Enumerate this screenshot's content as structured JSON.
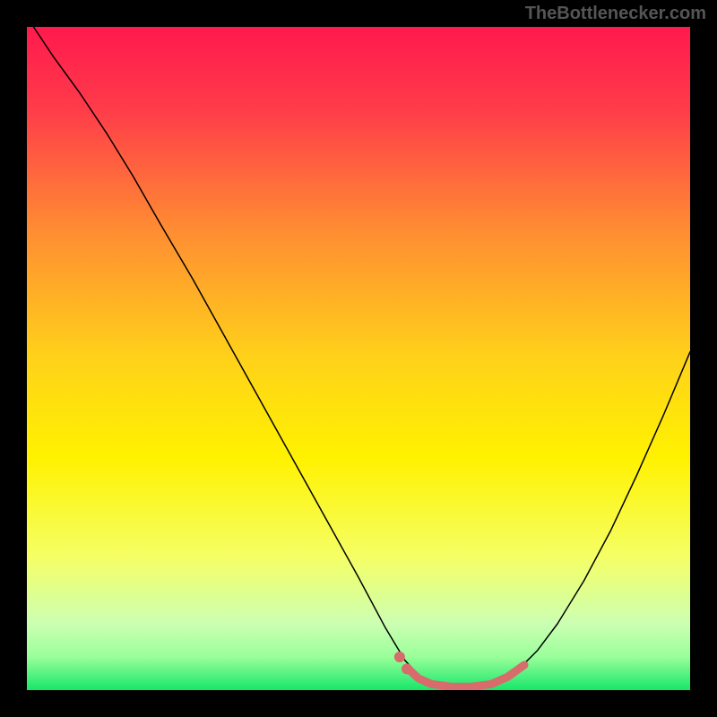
{
  "watermark": "TheBottlenecker.com",
  "chart_data": {
    "type": "line",
    "title": "",
    "xlabel": "",
    "ylabel": "",
    "xlim": [
      0,
      100
    ],
    "ylim": [
      0,
      100
    ],
    "background_gradient_stops": [
      {
        "pct": 0,
        "color": "#ff1a4d"
      },
      {
        "pct": 12,
        "color": "#ff3a4a"
      },
      {
        "pct": 30,
        "color": "#ff8a33"
      },
      {
        "pct": 50,
        "color": "#ffd21a"
      },
      {
        "pct": 65,
        "color": "#fff200"
      },
      {
        "pct": 80,
        "color": "#f5ff66"
      },
      {
        "pct": 90,
        "color": "#ccffb3"
      },
      {
        "pct": 95,
        "color": "#99ff99"
      },
      {
        "pct": 100,
        "color": "#17e66b"
      }
    ],
    "series": [
      {
        "name": "bottleneck-curve",
        "color": "#000000",
        "width": 1.5,
        "points": [
          {
            "x": 1.0,
            "y": 100.0
          },
          {
            "x": 4.0,
            "y": 95.5
          },
          {
            "x": 8.0,
            "y": 90.0
          },
          {
            "x": 12.0,
            "y": 84.0
          },
          {
            "x": 16.0,
            "y": 77.5
          },
          {
            "x": 20.0,
            "y": 70.5
          },
          {
            "x": 25.0,
            "y": 62.0
          },
          {
            "x": 30.0,
            "y": 53.0
          },
          {
            "x": 35.0,
            "y": 44.0
          },
          {
            "x": 40.0,
            "y": 35.0
          },
          {
            "x": 45.0,
            "y": 26.0
          },
          {
            "x": 50.0,
            "y": 17.0
          },
          {
            "x": 54.0,
            "y": 9.5
          },
          {
            "x": 57.0,
            "y": 4.5
          },
          {
            "x": 59.5,
            "y": 1.8
          },
          {
            "x": 62.0,
            "y": 0.6
          },
          {
            "x": 65.0,
            "y": 0.3
          },
          {
            "x": 68.0,
            "y": 0.5
          },
          {
            "x": 71.0,
            "y": 1.2
          },
          {
            "x": 74.0,
            "y": 3.0
          },
          {
            "x": 77.0,
            "y": 6.0
          },
          {
            "x": 80.0,
            "y": 10.0
          },
          {
            "x": 84.0,
            "y": 16.5
          },
          {
            "x": 88.0,
            "y": 24.0
          },
          {
            "x": 92.0,
            "y": 32.5
          },
          {
            "x": 96.0,
            "y": 41.5
          },
          {
            "x": 100.0,
            "y": 51.0
          }
        ]
      },
      {
        "name": "highlight-bottom-band",
        "color": "#d86b6b",
        "width": 9,
        "points": [
          {
            "x": 57.5,
            "y": 3.2
          },
          {
            "x": 59.0,
            "y": 1.8
          },
          {
            "x": 61.0,
            "y": 0.9
          },
          {
            "x": 64.0,
            "y": 0.5
          },
          {
            "x": 67.0,
            "y": 0.5
          },
          {
            "x": 70.0,
            "y": 0.9
          },
          {
            "x": 72.5,
            "y": 2.0
          },
          {
            "x": 75.0,
            "y": 3.8
          }
        ]
      }
    ],
    "highlight_dots": {
      "color": "#d86b6b",
      "radius": 6,
      "points": [
        {
          "x": 56.2,
          "y": 5.0
        },
        {
          "x": 57.3,
          "y": 3.2
        }
      ]
    }
  }
}
